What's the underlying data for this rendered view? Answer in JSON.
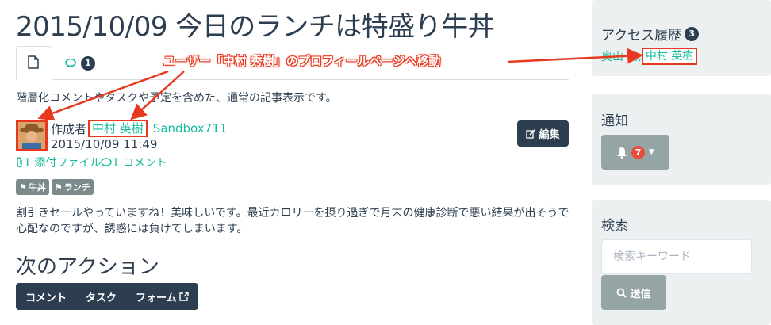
{
  "page": {
    "title": "2015/10/09 今日のランチは特盛り牛丼"
  },
  "tabs": {
    "comment_count": "1"
  },
  "annotation": {
    "text": "ユーザー「中村 秀樹」のプロフィールページへ移動"
  },
  "post": {
    "description": "階層化コメントやタスクや予定を含めた、通常の記事表示です。",
    "author_prefix": "作成者",
    "author_name": "中村 英樹",
    "group": "Sandbox711",
    "date": "2015/10/09 11:49",
    "edit_label": "編集",
    "attachments_label": "1 添付ファイル",
    "comments_label": "1 コメント",
    "tags": [
      "牛丼",
      "ランチ"
    ],
    "body": "割引きセールやっていますね！美味しいです。最近カロリーを摂り過ぎで月末の健康診断で悪い結果が出そうで心配なのですが、誘惑には負けてしまいます。"
  },
  "actions": {
    "title": "次のアクション",
    "buttons": [
      "コメント",
      "タスク",
      "フォーム"
    ]
  },
  "sidebar": {
    "history": {
      "title": "アクセス履歴",
      "count": "3",
      "link_partial": "奥山 岳,",
      "link_highlighted": "中村 英樹"
    },
    "notifications": {
      "title": "通知",
      "count": "7"
    },
    "search": {
      "title": "検索",
      "placeholder": "検索キーワード",
      "submit_label": "送信"
    }
  },
  "colors": {
    "primary": "#2c3e50",
    "link": "#18bc9c",
    "annotation": "#e8391e",
    "sidebar_bg": "#ecf0f1",
    "button_gray": "#95a5a6"
  }
}
